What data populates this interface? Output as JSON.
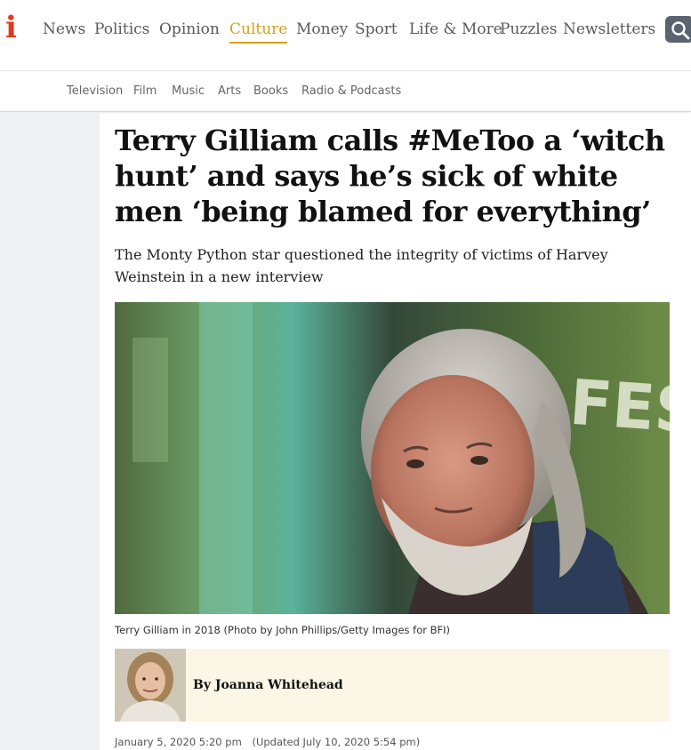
{
  "brand": {
    "logo_text": "i",
    "logo_color": "#e03a1e",
    "accent_color": "#d4a017"
  },
  "nav": {
    "items": [
      {
        "label": "News"
      },
      {
        "label": "Politics"
      },
      {
        "label": "Opinion"
      },
      {
        "label": "Culture",
        "active": true
      },
      {
        "label": "Money"
      },
      {
        "label": "Sport"
      },
      {
        "label": "Life & More"
      },
      {
        "label": "Puzzles"
      },
      {
        "label": "Newsletters"
      }
    ],
    "search_icon": "search-icon"
  },
  "subnav": {
    "items": [
      {
        "label": "Television"
      },
      {
        "label": "Film"
      },
      {
        "label": "Music"
      },
      {
        "label": "Arts"
      },
      {
        "label": "Books"
      },
      {
        "label": "Radio & Podcasts"
      }
    ]
  },
  "article": {
    "headline": "Terry Gilliam calls #MeToo a ‘witch hunt’ and says he’s sick of white men ‘being blamed for everything’",
    "standfirst": "The Monty Python star questioned the integrity of victims of Harvey Weinstein in a new interview",
    "image_caption": "Terry Gilliam in 2018 (Photo by John Phillips/Getty Images for BFI)",
    "byline": "By Joanna Whitehead",
    "published": "January 5, 2020 5:20 pm",
    "updated": "(Updated July 10, 2020 5:54 pm)"
  }
}
